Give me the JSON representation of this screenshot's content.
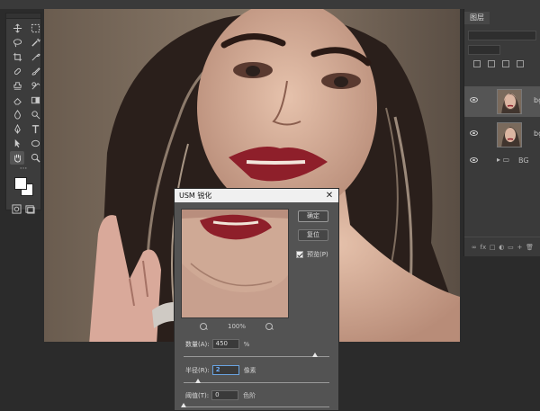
{
  "toolbox": {
    "tools": [
      [
        "move-icon",
        "marquee-icon"
      ],
      [
        "lasso-icon",
        "magic-wand-icon"
      ],
      [
        "crop-icon",
        "eyedropper-icon"
      ],
      [
        "healing-icon",
        "brush-icon"
      ],
      [
        "stamp-icon",
        "history-brush-icon"
      ],
      [
        "eraser-icon",
        "gradient-icon"
      ],
      [
        "blur-icon",
        "dodge-icon"
      ],
      [
        "pen-icon",
        "text-icon"
      ],
      [
        "path-select-icon",
        "ellipse-icon"
      ],
      [
        "hand-icon",
        "zoom-icon"
      ]
    ],
    "more_glyph": "···",
    "active_tool": "hand-icon"
  },
  "layers_panel": {
    "tab_label": "图层",
    "layers": [
      {
        "name": "bg",
        "selected": true
      },
      {
        "name": "bg",
        "selected": false
      }
    ],
    "group": {
      "name": "BG"
    },
    "bottom_icons": [
      "∞",
      "fx",
      "□",
      "◐",
      "▭",
      "+",
      "🗑"
    ]
  },
  "dialog": {
    "title": "USM 锐化",
    "close_glyph": "✕",
    "ok_label": "确定",
    "reset_label": "复位",
    "preview_label": "预览(P)",
    "preview_checked": true,
    "zoom_level": "100%",
    "amount": {
      "label": "数量(A):",
      "value": "450",
      "unit": "%",
      "slider": 0.9
    },
    "radius": {
      "label": "半径(R):",
      "value": "2",
      "unit": "像素",
      "slider": 0.1
    },
    "threshold": {
      "label": "阈值(T):",
      "value": "0",
      "unit": "色阶",
      "slider": 0.0
    }
  },
  "colors": {
    "accent_focus": "#6fb0ff",
    "dialog_bg": "#535353",
    "app_bg": "#2b2b2b"
  }
}
